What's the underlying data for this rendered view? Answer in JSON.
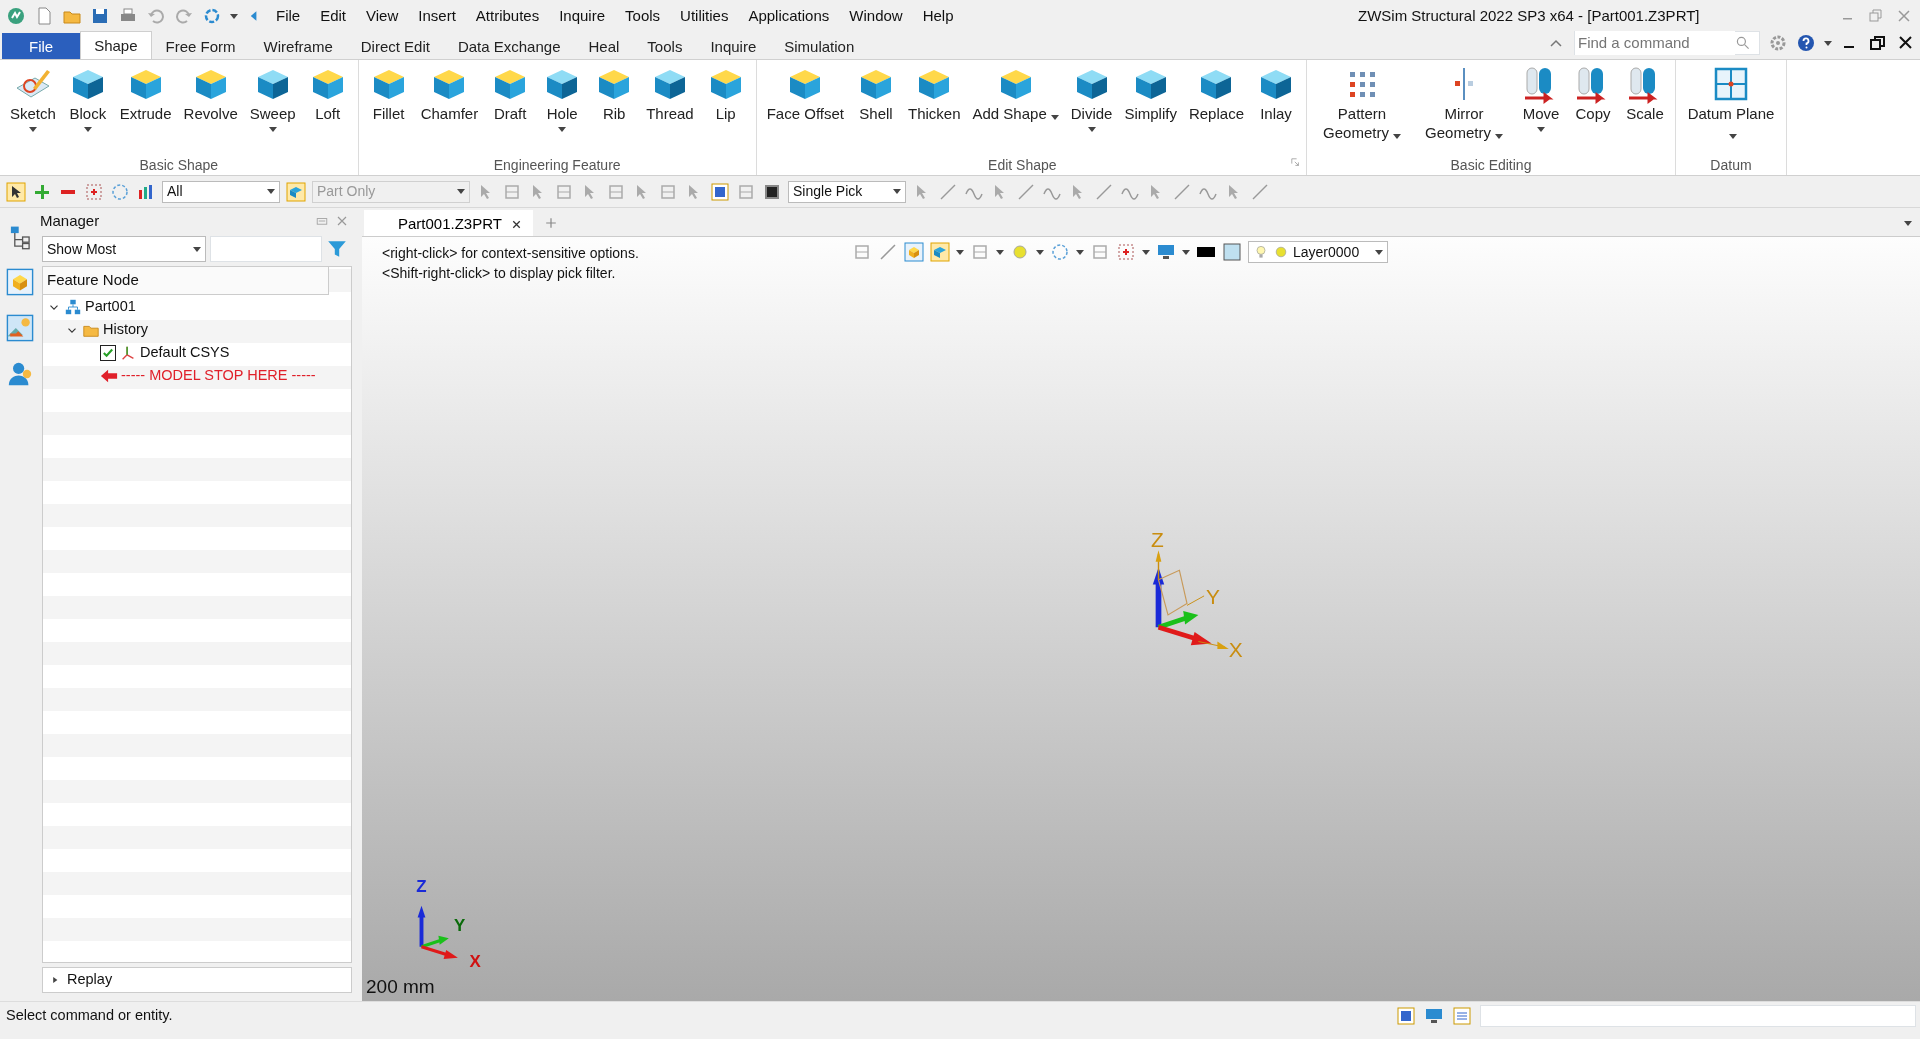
{
  "title_bar": {
    "title": "ZWSim Structural 2022 SP3 x64 - [Part001.Z3PRT]",
    "menu": [
      "File",
      "Edit",
      "View",
      "Insert",
      "Attributes",
      "Inquire",
      "Tools",
      "Utilities",
      "Applications",
      "Window",
      "Help"
    ]
  },
  "ribbon_tabs": [
    {
      "label": "File",
      "kind": "file",
      "selected": false
    },
    {
      "label": "Shape",
      "kind": "tab",
      "selected": true
    },
    {
      "label": "Free Form",
      "kind": "tab",
      "selected": false
    },
    {
      "label": "Wireframe",
      "kind": "tab",
      "selected": false
    },
    {
      "label": "Direct Edit",
      "kind": "tab",
      "selected": false
    },
    {
      "label": "Data Exchange",
      "kind": "tab",
      "selected": false
    },
    {
      "label": "Heal",
      "kind": "tab",
      "selected": false
    },
    {
      "label": "Tools",
      "kind": "tab",
      "selected": false
    },
    {
      "label": "Inquire",
      "kind": "tab",
      "selected": false
    },
    {
      "label": "Simulation",
      "kind": "tab",
      "selected": false
    }
  ],
  "command_search": {
    "placeholder": "Find a command"
  },
  "ribbon_groups": [
    {
      "label": "Basic Shape",
      "launcher": false,
      "buttons": [
        {
          "label": "Sketch",
          "dropdown": true,
          "two_line": false
        },
        {
          "label": "Block",
          "dropdown": true,
          "two_line": false
        },
        {
          "label": "Extrude",
          "dropdown": false,
          "two_line": false
        },
        {
          "label": "Revolve",
          "dropdown": false,
          "two_line": false
        },
        {
          "label": "Sweep",
          "dropdown": true,
          "two_line": false
        },
        {
          "label": "Loft",
          "dropdown": false,
          "two_line": false
        }
      ]
    },
    {
      "label": "Engineering Feature",
      "launcher": false,
      "buttons": [
        {
          "label": "Fillet",
          "dropdown": false,
          "two_line": false
        },
        {
          "label": "Chamfer",
          "dropdown": false,
          "two_line": false
        },
        {
          "label": "Draft",
          "dropdown": false,
          "two_line": false
        },
        {
          "label": "Hole",
          "dropdown": true,
          "two_line": false
        },
        {
          "label": "Rib",
          "dropdown": false,
          "two_line": false
        },
        {
          "label": "Thread",
          "dropdown": false,
          "two_line": false
        },
        {
          "label": "Lip",
          "dropdown": false,
          "two_line": false
        }
      ]
    },
    {
      "label": "Edit Shape",
      "launcher": true,
      "buttons": [
        {
          "label": "Face Offset",
          "dropdown": false,
          "two_line": true
        },
        {
          "label": "Shell",
          "dropdown": false,
          "two_line": false
        },
        {
          "label": "Thicken",
          "dropdown": false,
          "two_line": false
        },
        {
          "label": "Add Shape",
          "dropdown": true,
          "two_line": true
        },
        {
          "label": "Divide",
          "dropdown": true,
          "two_line": false
        },
        {
          "label": "Simplify",
          "dropdown": false,
          "two_line": false
        },
        {
          "label": "Replace",
          "dropdown": false,
          "two_line": false
        },
        {
          "label": "Inlay",
          "dropdown": false,
          "two_line": false
        }
      ]
    },
    {
      "label": "Basic Editing",
      "launcher": false,
      "buttons": [
        {
          "label": "Pattern Geometry",
          "dropdown": true,
          "two_line": true
        },
        {
          "label": "Mirror Geometry",
          "dropdown": true,
          "two_line": true
        },
        {
          "label": "Move",
          "dropdown": true,
          "two_line": false
        },
        {
          "label": "Copy",
          "dropdown": false,
          "two_line": false
        },
        {
          "label": "Scale",
          "dropdown": false,
          "two_line": false
        }
      ]
    },
    {
      "label": "Datum",
      "launcher": false,
      "buttons": [
        {
          "label": "Datum Plane",
          "dropdown": true,
          "two_line": true
        }
      ]
    }
  ],
  "toolbar": {
    "filter": {
      "value": "All",
      "disabled": false
    },
    "scope": {
      "value": "Part Only",
      "disabled": true
    },
    "pick": {
      "value": "Single Pick",
      "disabled": false
    }
  },
  "manager": {
    "title": "Manager",
    "view": "Show Most",
    "column": "Feature Node",
    "tree": [
      {
        "label": "Part001",
        "kind": "part",
        "expanded": true,
        "children": [
          {
            "label": "History",
            "kind": "folder",
            "expanded": true,
            "children": [
              {
                "label": "Default CSYS",
                "kind": "csys",
                "checked": true
              },
              {
                "label": "----- MODEL STOP HERE -----",
                "kind": "stop"
              }
            ]
          }
        ]
      }
    ],
    "replay": "Replay"
  },
  "document_tabs": [
    {
      "label": "Part001.Z3PRT",
      "selected": true
    }
  ],
  "viewport": {
    "hints": [
      "<right-click> for context-sensitive options.",
      "<Shift-right-click> to display pick filter."
    ],
    "layer": "Layer0000",
    "triad_labels": [
      "Z",
      "Y",
      "X"
    ],
    "mini_triad_labels": [
      "Z",
      "Y",
      "X"
    ],
    "scale": "200 mm"
  },
  "status_bar": {
    "message": "Select command or entity."
  }
}
